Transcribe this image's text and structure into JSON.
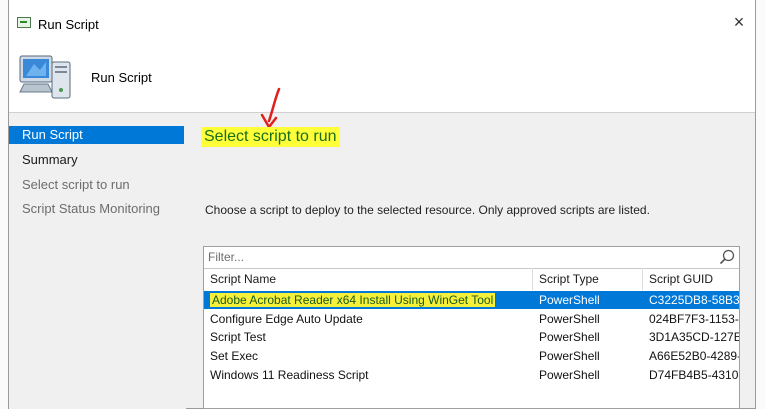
{
  "window": {
    "title": "Run Script",
    "close_label": "×"
  },
  "header": {
    "title": "Run Script"
  },
  "sidebar": {
    "items": [
      {
        "label": "Run Script"
      },
      {
        "label": "Summary"
      },
      {
        "label": "Select script to run"
      },
      {
        "label": "Script Status Monitoring"
      }
    ]
  },
  "main": {
    "heading": "Select script to run",
    "description": "Choose a script to deploy to the selected resource. Only approved scripts are listed.",
    "filter_placeholder": "Filter...",
    "columns": [
      "Script Name",
      "Script Type",
      "Script GUID"
    ],
    "rows": [
      {
        "name": "Adobe Acrobat Reader x64 Install Using WinGet Tool",
        "type": "PowerShell",
        "guid": "C3225DB8-58B3-4"
      },
      {
        "name": "Configure Edge Auto Update",
        "type": "PowerShell",
        "guid": "024BF7F3-1153-4"
      },
      {
        "name": "Script Test",
        "type": "PowerShell",
        "guid": "3D1A35CD-127E-"
      },
      {
        "name": "Set Exec",
        "type": "PowerShell",
        "guid": "A66E52B0-4289-4"
      },
      {
        "name": "Windows 11 Readiness Script",
        "type": "PowerShell",
        "guid": "D74FB4B5-4310-4"
      }
    ]
  },
  "colors": {
    "selection": "#0078d7",
    "highlight": "#ffff3a",
    "annotation": "#e0201a"
  },
  "icons": {
    "title": "run-script-app-icon",
    "header": "computer-icon",
    "search": "magnifier-icon"
  }
}
